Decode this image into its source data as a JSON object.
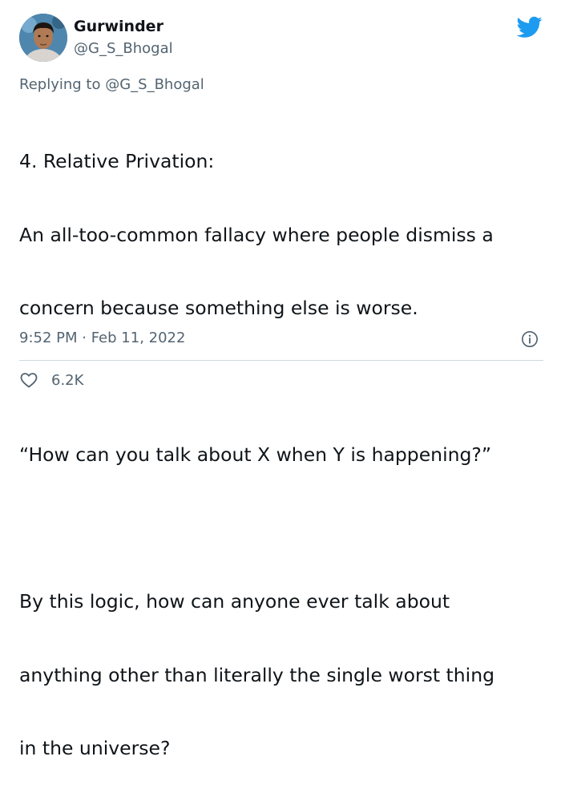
{
  "author": {
    "display_name": "Gurwinder",
    "handle": "@G_S_Bhogal",
    "avatar_icon": "profile-photo"
  },
  "brand": {
    "logo_icon": "twitter-bird-icon",
    "accent_color": "#1d9bf0"
  },
  "reply": {
    "prefix": "Replying to ",
    "mention": "@G_S_Bhogal"
  },
  "tweet": {
    "lines": [
      "4. Relative Privation:",
      "An all-too-common fallacy where people dismiss a",
      "concern because something else is worse.",
      "",
      "“How can you talk about X when Y is happening?”",
      "",
      "By this logic, how can anyone ever talk about",
      "anything other than literally the single worst thing",
      "in the universe?"
    ],
    "timestamp": "9:52 PM · Feb 11, 2022"
  },
  "actions": {
    "like_count": "6.2K",
    "like_icon": "heart-icon",
    "info_icon": "info-icon"
  },
  "colors": {
    "text_primary": "#0f1419",
    "text_secondary": "#536471",
    "divider": "#cfd9de"
  }
}
